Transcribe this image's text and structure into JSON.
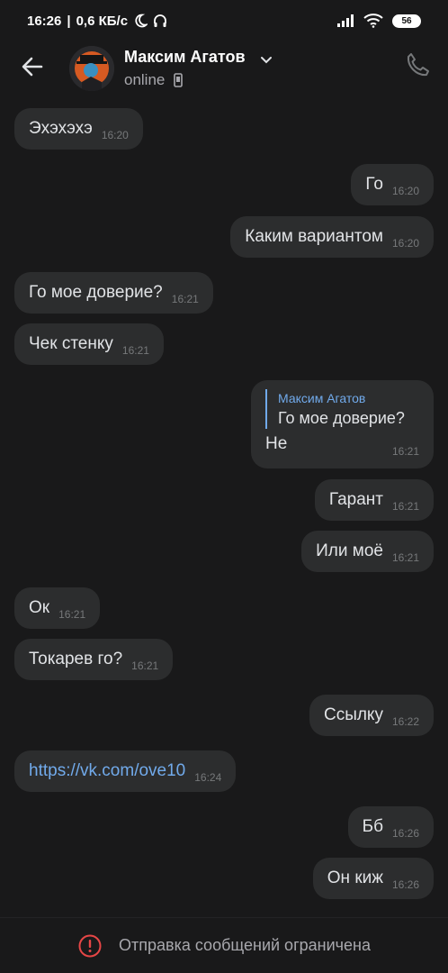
{
  "status_bar": {
    "time": "16:26",
    "speed": "0,6 КБ/с",
    "battery": "56"
  },
  "header": {
    "name": "Максим Агатов",
    "status": "online"
  },
  "messages": [
    {
      "side": "in",
      "text": "Эхэхэхэ",
      "time": "16:20"
    },
    {
      "side": "out",
      "text": "Го",
      "time": "16:20"
    },
    {
      "side": "out",
      "text": "Каким вариантом",
      "time": "16:20"
    },
    {
      "side": "in",
      "text": "Го мое доверие?",
      "time": "16:21"
    },
    {
      "side": "in",
      "text": "Чек стенку",
      "time": "16:21"
    },
    {
      "side": "out",
      "reply_author": "Максим Агатов",
      "reply_text": "Го мое доверие?",
      "text": "Не",
      "time": "16:21"
    },
    {
      "side": "out",
      "text": "Гарант",
      "time": "16:21"
    },
    {
      "side": "out",
      "text": "Или моё",
      "time": "16:21"
    },
    {
      "side": "in",
      "text": "Ок",
      "time": "16:21"
    },
    {
      "side": "in",
      "text": "Токарев го?",
      "time": "16:21"
    },
    {
      "side": "out",
      "text": "Ссылку",
      "time": "16:22"
    },
    {
      "side": "in",
      "text": "https://vk.com/ove10",
      "time": "16:24",
      "is_link": true
    },
    {
      "side": "out",
      "text": "Бб",
      "time": "16:26"
    },
    {
      "side": "out",
      "text": "Он киж",
      "time": "16:26"
    }
  ],
  "bottom_bar": {
    "notice": "Отправка сообщений ограничена"
  },
  "colors": {
    "background": "#19191a",
    "bubble": "#2c2d2e",
    "link": "#71aaeb",
    "alert": "#e64646"
  },
  "icons": [
    "back-arrow-icon",
    "chevron-down-icon",
    "mobile-icon",
    "phone-icon",
    "alert-icon",
    "moon-icon",
    "headphones-icon",
    "signal-icon",
    "wifi-icon"
  ]
}
